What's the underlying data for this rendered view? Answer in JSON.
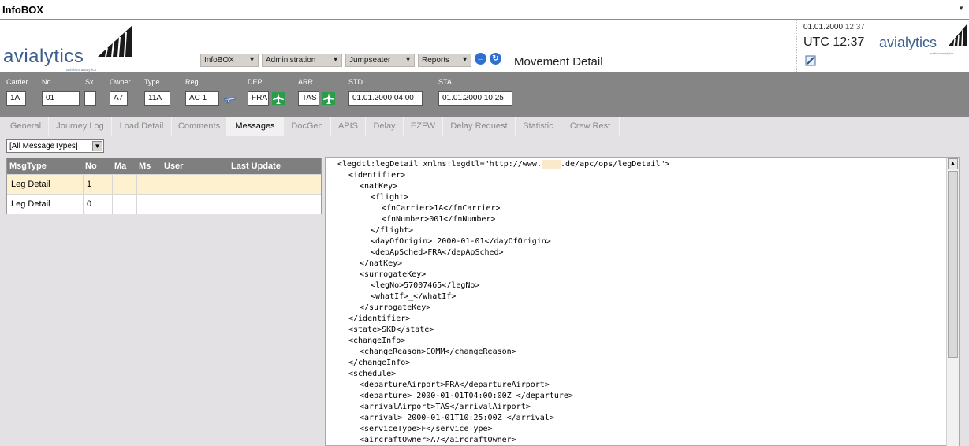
{
  "app": {
    "title": "InfoBOX"
  },
  "logo": {
    "word": "avialytics",
    "tagline": "aviation analytics"
  },
  "menus": [
    {
      "label": "InfoBOX"
    },
    {
      "label": "Administration"
    },
    {
      "label": "Jumpseater"
    },
    {
      "label": "Reports"
    }
  ],
  "page_title": "Movement Detail",
  "clock": {
    "date": "01.01.2000",
    "time": "12:37",
    "utc": "UTC 12:37"
  },
  "flight": {
    "labels": {
      "carrier": "Carrier",
      "no": "No",
      "sx": "Sx",
      "owner": "Owner",
      "type": "Type",
      "reg": "Reg",
      "dep": "DEP",
      "arr": "ARR",
      "std": "STD",
      "sta": "STA"
    },
    "carrier": "1A",
    "no": "01",
    "sx": "",
    "owner": "A7",
    "type": "11A",
    "reg": "AC 1",
    "dep": "FRA",
    "arr": "TAS",
    "std": "01.01.2000 04:00",
    "sta": "01.01.2000 10:25"
  },
  "tabs": [
    {
      "label": "General"
    },
    {
      "label": "Journey Log"
    },
    {
      "label": "Load Detail"
    },
    {
      "label": "Comments"
    },
    {
      "label": "Messages",
      "active": true
    },
    {
      "label": "DocGen"
    },
    {
      "label": "APIS"
    },
    {
      "label": "Delay"
    },
    {
      "label": "EZFW"
    },
    {
      "label": "Delay Request"
    },
    {
      "label": "Statistic"
    },
    {
      "label": "Crew Rest"
    }
  ],
  "filter": {
    "selected": "[All MessageTypes]"
  },
  "messages": {
    "columns": [
      "MsgType",
      "No",
      "Ma",
      "Ms",
      "User",
      "Last Update"
    ],
    "rows": [
      {
        "type": "Leg Detail",
        "no": "1",
        "ma": "",
        "ms": "",
        "user": "",
        "last_update": "",
        "selected": true
      },
      {
        "type": "Leg Detail",
        "no": "0",
        "ma": "",
        "ms": "",
        "user": "",
        "last_update": "",
        "selected": false
      }
    ]
  },
  "xml": {
    "lines": [
      {
        "indent": 0,
        "text": "<legdtl:legDetail xmlns:legdtl=\"http://www.",
        "masked": "    ",
        "after": ".de/apc/ops/legDetail\">"
      },
      {
        "indent": 1,
        "text": "<identifier>"
      },
      {
        "indent": 2,
        "text": "<natKey>"
      },
      {
        "indent": 3,
        "text": "<flight>"
      },
      {
        "indent": 4,
        "text": "<fnCarrier>1A</fnCarrier>"
      },
      {
        "indent": 4,
        "text": "<fnNumber>001</fnNumber>"
      },
      {
        "indent": 3,
        "text": "</flight>"
      },
      {
        "indent": 3,
        "text": "<dayOfOrigin> 2000-01-01</dayOfOrigin>"
      },
      {
        "indent": 3,
        "text": "<depApSched>FRA</depApSched>"
      },
      {
        "indent": 2,
        "text": "</natKey>"
      },
      {
        "indent": 2,
        "text": "<surrogateKey>"
      },
      {
        "indent": 3,
        "text": "<legNo>57007465</legNo>"
      },
      {
        "indent": 3,
        "text": "<whatIf>_</whatIf>"
      },
      {
        "indent": 2,
        "text": "</surrogateKey>"
      },
      {
        "indent": 1,
        "text": "</identifier>"
      },
      {
        "indent": 1,
        "text": "<state>SKD</state>"
      },
      {
        "indent": 1,
        "text": "<changeInfo>"
      },
      {
        "indent": 2,
        "text": "<changeReason>COMM</changeReason>"
      },
      {
        "indent": 1,
        "text": "</changeInfo>"
      },
      {
        "indent": 1,
        "text": "<schedule>"
      },
      {
        "indent": 2,
        "text": "<departureAirport>FRA</departureAirport>"
      },
      {
        "indent": 2,
        "text": "<departure> 2000-01-01T04:00:00Z </departure>"
      },
      {
        "indent": 2,
        "text": "<arrivalAirport>TAS</arrivalAirport>"
      },
      {
        "indent": 2,
        "text": "<arrival> 2000-01-01T10:25:00Z </arrival>"
      },
      {
        "indent": 2,
        "text": "<serviceType>F</serviceType>"
      },
      {
        "indent": 2,
        "text": "<aircraftOwner>A7</aircraftOwner>"
      }
    ]
  }
}
